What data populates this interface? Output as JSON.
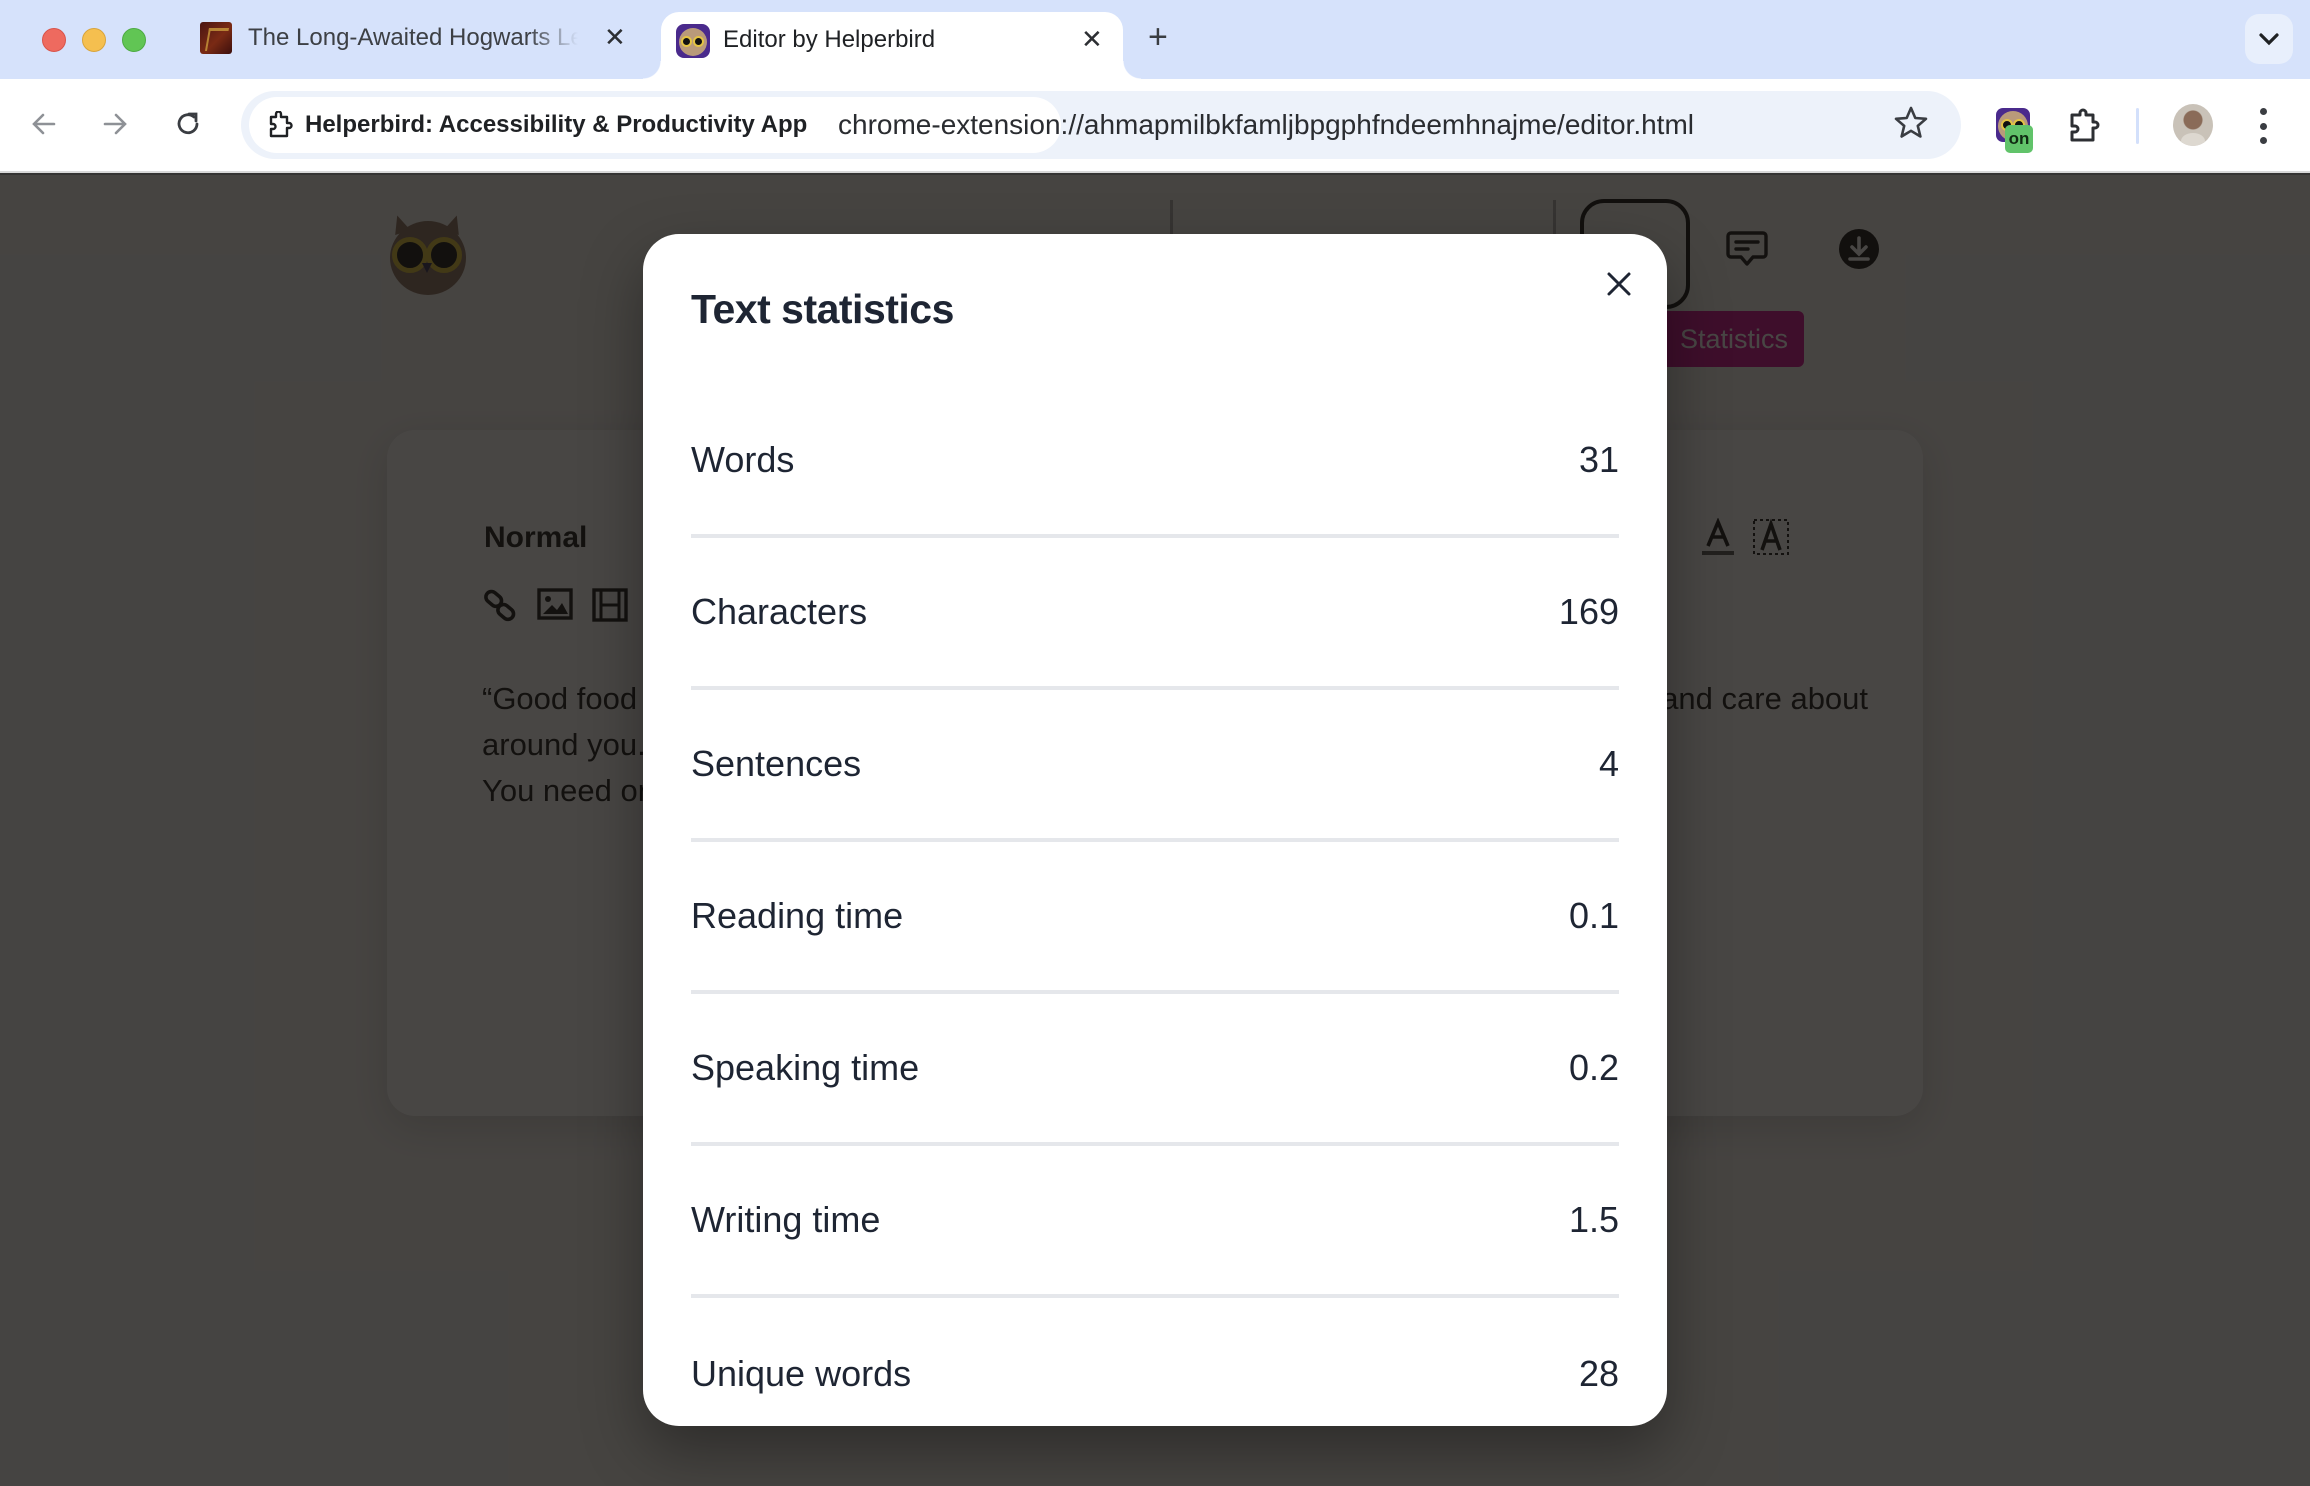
{
  "browser": {
    "tabs": [
      {
        "title": "The Long-Awaited Hogwarts Legacy",
        "active": false
      },
      {
        "title": "Editor by Helperbird",
        "active": true
      }
    ],
    "site_chip": "Helperbird: Accessibility & Productivity App",
    "url": "chrome-extension://ahmapmilbkfamljbpgphfndeemhnajme/editor.html",
    "extension_badge": "on"
  },
  "app": {
    "stats_badge_label": "Statistics",
    "editor": {
      "format_select": "Normal",
      "text_line_1": "“Good food is very often, even most often, simple food. Walk with the people you love and care about around you.",
      "text_line_2": "You need only lift up your eyes to see them."
    },
    "colors": {
      "accent": "#d1008c"
    }
  },
  "modal": {
    "title": "Text statistics",
    "close_label": "Close",
    "stats": [
      {
        "label": "Words",
        "value": "31"
      },
      {
        "label": "Characters",
        "value": "169"
      },
      {
        "label": "Sentences",
        "value": "4"
      },
      {
        "label": "Reading time",
        "value": "0.1"
      },
      {
        "label": "Speaking time",
        "value": "0.2"
      },
      {
        "label": "Writing time",
        "value": "1.5"
      },
      {
        "label": "Unique words",
        "value": "28"
      }
    ]
  }
}
